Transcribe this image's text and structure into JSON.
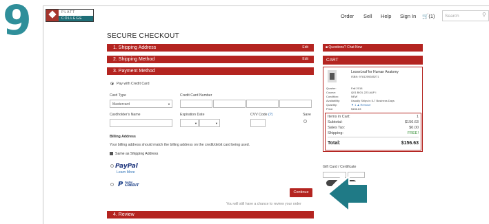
{
  "step": "9",
  "logo": {
    "line1": "PLATT",
    "line2": "COLLEGE"
  },
  "nav": {
    "items": [
      "Order",
      "Sell",
      "Help",
      "Sign In"
    ],
    "cart_count": "(1)",
    "search_placeholder": "Search"
  },
  "page_title": "SECURE CHECKOUT",
  "sections": {
    "shipping_address": {
      "label": "1. Shipping Address",
      "edit": "Edit"
    },
    "shipping_method": {
      "label": "2. Shipping Method",
      "edit": "Edit"
    },
    "payment_method": {
      "label": "3. Payment Method"
    },
    "review": {
      "label": "4. Review"
    }
  },
  "payment": {
    "pay_with_credit_card": "Pay with Credit Card",
    "card_type_label": "Card Type",
    "card_type_value": "Mastercard",
    "card_number_label": "Credit Card Number",
    "cardholder_label": "Cardholder's Name",
    "expiration_label": "Expiration Date",
    "cvv_label": "CVV Code",
    "cvv_help": "(?)",
    "save_label": "Save",
    "billing_title": "Billing Address",
    "billing_note": "Your billing address should match the billing address on the credit/debit card being used.",
    "same_as_shipping": "Same as Shipping Address",
    "paypal": "PayPal",
    "learn_more": "Learn More",
    "paypal_small": "PayPal",
    "credit": "CREDIT",
    "continue": "Continue",
    "review_note": "You will still have a chance to review your order"
  },
  "sidebar": {
    "chat": "Questions? Chat Now",
    "cart_title": "CART",
    "item": {
      "title": "LooseLeaf for Human Anatomy",
      "isbn": "ISBN: 9781259285271",
      "rows": [
        {
          "k": "Quarter:",
          "v": "Fall 2018"
        },
        {
          "k": "Course:",
          "v": "Q01 BIOL 223 A&P I"
        },
        {
          "k": "Condition:",
          "v": "NEW"
        },
        {
          "k": "Availability:",
          "v": "Usually Ships in 5-7 Business Days"
        },
        {
          "k": "Quantity:",
          "v": "1"
        },
        {
          "k": "Price:",
          "v": "$156.63"
        }
      ],
      "remove": "Remove"
    },
    "summary": {
      "items_label": "Items in Cart:",
      "items_value": "1",
      "subtotal_label": "Subtotal:",
      "subtotal_value": "$156.63",
      "tax_label": "Sales Tax:",
      "tax_value": "$0.00",
      "shipping_label": "Shipping:",
      "shipping_value": "FREE!",
      "total_label": "Total:",
      "total_value": "$156.63"
    },
    "gift_card_label": "Gift Card / Certificate"
  },
  "colors": {
    "brand_red": "#b42420",
    "teal": "#2f8f9a",
    "arrow": "#1f7a86"
  }
}
